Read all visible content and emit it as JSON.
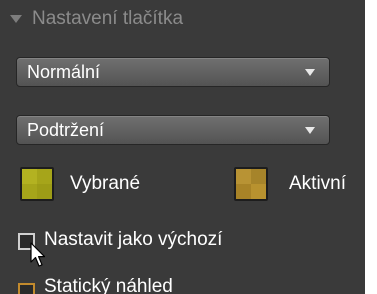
{
  "section": {
    "title": "Nastavení tlačítka"
  },
  "dropdowns": [
    {
      "value": "Normální"
    },
    {
      "value": "Podtržení"
    }
  ],
  "swatches": [
    {
      "label": "Vybrané",
      "color": "#a6a51a"
    },
    {
      "label": "Aktivní",
      "color": "#b08c2d"
    }
  ],
  "checkboxes": [
    {
      "label": "Nastavit jako výchozí",
      "checked": false
    },
    {
      "label": "Statický náhled",
      "checked": false
    }
  ]
}
